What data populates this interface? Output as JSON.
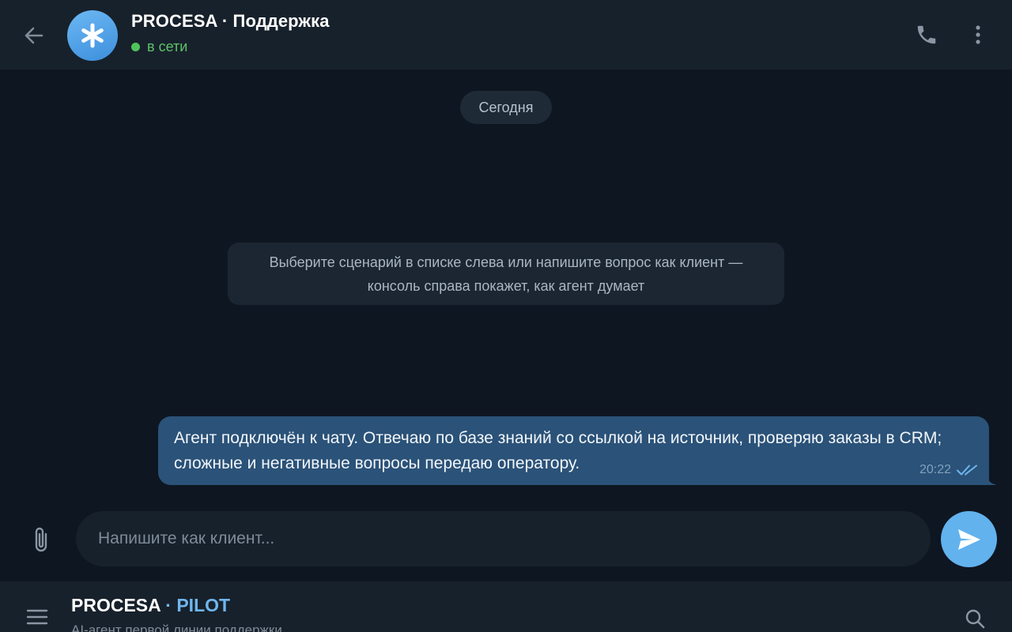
{
  "header": {
    "title": "PROCESA · Поддержка",
    "status": "в сети",
    "status_color": "#4fc35b",
    "icons": [
      "back-arrow-icon",
      "asterisk-icon",
      "phone-icon",
      "more-vertical-icon"
    ]
  },
  "messages": {
    "date_badge": "Сегодня",
    "service_text": "Выберите сценарий в списке слева или напишите вопрос как клиент — консоль справа покажет, как агент думает",
    "outgoing": [
      {
        "text": "Агент подключён к чату. Отвечаю по базе знаний со ссылкой на источник, проверяю заказы в CRM; сложные и негативные вопросы передаю оператору.",
        "time": "20:22",
        "status": "read"
      }
    ]
  },
  "composer": {
    "placeholder": "Напишите как клиент...",
    "value": "",
    "icons": [
      "paperclip-icon",
      "send-icon"
    ]
  },
  "bottom_bar": {
    "brand_main": "PROCESA",
    "brand_separator": "·",
    "brand_accent": "PILOT",
    "subtitle": "AI-агент первой линии поддержки",
    "icons": [
      "menu-icon",
      "search-icon"
    ]
  },
  "colors": {
    "background": "#0e1621",
    "panel": "#17212b",
    "bubble_out": "#2b5278",
    "accent": "#62b2ee"
  }
}
